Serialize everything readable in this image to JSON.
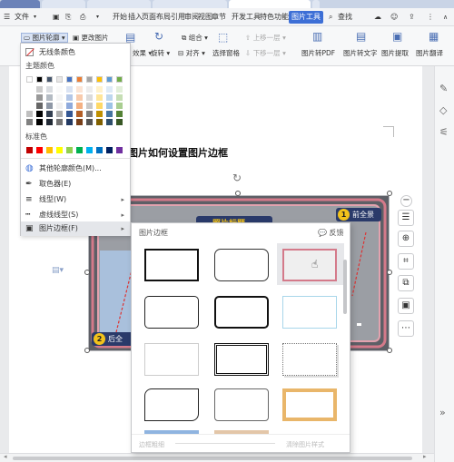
{
  "colors": {
    "accent": "#3d6fd6",
    "image_border_pink": "#d47a8a",
    "badge_yellow": "#f2c21b",
    "badge_navy": "#2a3a6a",
    "selected_tile": "#e6e7ea"
  },
  "menubar": {
    "file_label": "文件",
    "menu_items": [
      "开始",
      "插入",
      "页面布局",
      "引用",
      "审阅",
      "视图",
      "章节",
      "开发工具",
      "特色功能"
    ],
    "picture_tools_label": "图片工具",
    "search_label": "查找"
  },
  "ribbon": {
    "outline_button_label": "图片轮廓",
    "change_picture_label": "更改图片",
    "group_label": "组合",
    "move_up_label": "上移一层",
    "move_down_label": "下移一层",
    "rotate_label": "旋转",
    "align_label": "对齐",
    "selection_pane_label": "选择窗格",
    "pic_to_pdf_label": "图片转PDF",
    "pic_to_text_label": "图片转文字",
    "pic_extract_label": "图片提取",
    "pic_translate_label": "图片翻译",
    "effects_label": "效果"
  },
  "outline_menu": {
    "no_line_color": "无线条颜色",
    "theme_colors_heading": "主题颜色",
    "standard_colors_heading": "标准色",
    "more_colors": "其他轮廓颜色(M)...",
    "eyedropper": "取色器(E)",
    "line_style": "线型(W)",
    "dash_style": "虚线线型(S)",
    "picture_border": "图片边框(F)",
    "theme_top_row": [
      "#ffffff",
      "#000000",
      "#44546a",
      "#e7e6e6",
      "#4472c4",
      "#ed7d31",
      "#a5a5a5",
      "#ffc000",
      "#5b9bd5",
      "#70ad47"
    ],
    "standard_colors": [
      "#c00000",
      "#ff0000",
      "#ffc000",
      "#ffff00",
      "#92d050",
      "#00b050",
      "#00b0f0",
      "#0070c0",
      "#002060",
      "#7030a0"
    ]
  },
  "document": {
    "title": "图片如何设置图片边框",
    "badge1_number": "1",
    "badge1_text": "前全景",
    "badge2_number": "2",
    "badge2_text": "后全",
    "banner_text": "照片标题"
  },
  "border_panel": {
    "title": "图片边框",
    "feedback": "反馈",
    "footer_left": "边框粗细",
    "footer_right": "清除图片样式"
  }
}
